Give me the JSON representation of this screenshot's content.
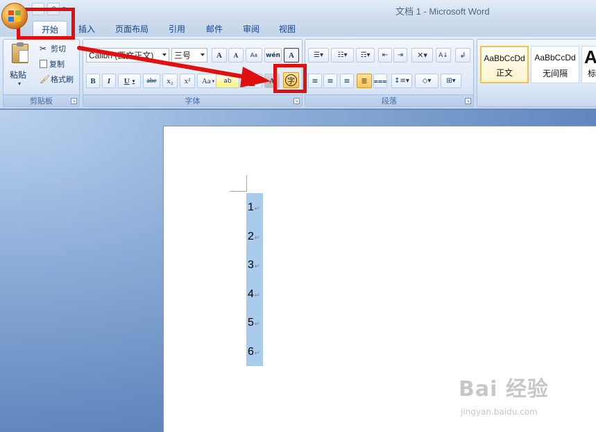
{
  "window": {
    "title": "文档 1 - Microsoft Word"
  },
  "tabs": [
    "开始",
    "插入",
    "页面布局",
    "引用",
    "邮件",
    "审阅",
    "视图"
  ],
  "clipboard": {
    "paste_label": "粘贴",
    "cut_label": "剪切",
    "copy_label": "复制",
    "format_painter_label": "格式刷",
    "group_label": "剪贴板"
  },
  "font": {
    "font_name": "Calibri (西文正文)",
    "font_size": "三号",
    "group_label": "字体",
    "grow_label": "A",
    "shrink_label": "A",
    "clear_label": "Aa",
    "phonetic_label": "wén",
    "border_char_label": "A",
    "bold_label": "B",
    "italic_label": "I",
    "underline_label": "U",
    "strike_label": "abe",
    "subscript_label": "x₂",
    "superscript_label": "x²",
    "case_label": "Aa",
    "highlight_label": "ab",
    "color_label": "A",
    "shading_label": "A",
    "enclose_char_label": "字"
  },
  "paragraph": {
    "group_label": "段落"
  },
  "styles": [
    {
      "sample": "AaBbCcDd",
      "name": "正文"
    },
    {
      "sample": "AaBbCcDd",
      "name": "无间隔"
    },
    {
      "sample": "A",
      "name": "标"
    }
  ],
  "document": {
    "lines": [
      "1",
      "2",
      "3",
      "4",
      "5",
      "6"
    ]
  },
  "watermark": {
    "brand": "Bai 经验",
    "url": "jingyan.baidu.com"
  },
  "colors": {
    "annotation_red": "#e01010",
    "highlight_yellow": "#f7c657",
    "selection_blue": "#a9cbee"
  }
}
